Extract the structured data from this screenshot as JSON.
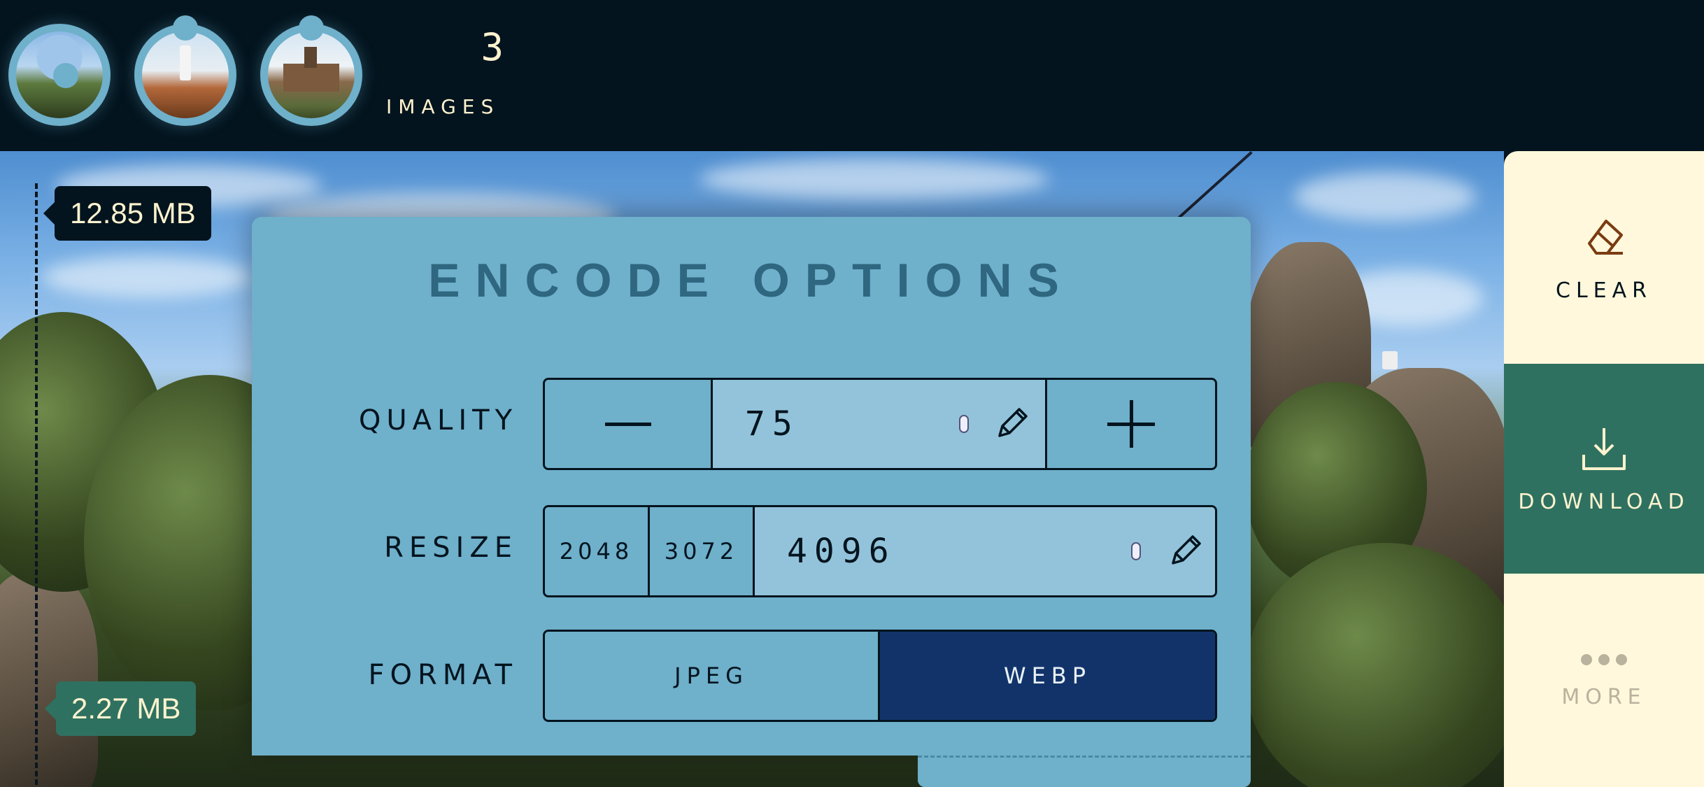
{
  "header": {
    "images_count": "3",
    "images_label": "IMAGES",
    "thumbnails": [
      {
        "name": "coastal-rocks-thumb"
      },
      {
        "name": "lighthouse-thumb"
      },
      {
        "name": "castle-thumb"
      }
    ]
  },
  "comparison": {
    "original_size": "12.85 MB",
    "compressed_size": "2.27 MB"
  },
  "panel": {
    "title": "ENCODE OPTIONS",
    "quality": {
      "label": "QUALITY",
      "value": "75"
    },
    "resize": {
      "label": "RESIZE",
      "presets": [
        "2048",
        "3072"
      ],
      "value": "4096"
    },
    "format": {
      "label": "FORMAT",
      "options": [
        "JPEG",
        "WEBP"
      ],
      "selected": "WEBP"
    }
  },
  "actions": {
    "clear": "CLEAR",
    "download": "DOWNLOAD",
    "more": "MORE"
  },
  "colors": {
    "background": "#03141e",
    "panel": "#6fb0cb",
    "field": "#93c3da",
    "selected_format": "#12336a",
    "download_bg": "#2f7160",
    "cream": "#fff8dc",
    "clear_icon": "#7a3b12"
  },
  "icons": [
    "minus-icon",
    "plus-icon",
    "pencil-icon",
    "spinner-icon",
    "eraser-icon",
    "download-icon",
    "more-dots-icon"
  ]
}
